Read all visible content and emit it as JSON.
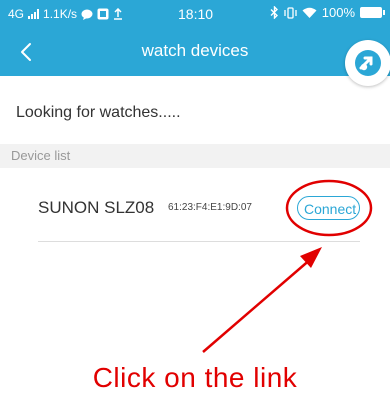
{
  "status_bar": {
    "network": "4G",
    "speed": "1.1K/s",
    "time": "18:10",
    "battery": "100%"
  },
  "nav": {
    "title": "watch devices",
    "back_icon": "chevron-left-icon",
    "settings_icon": "sync-settings-icon"
  },
  "main": {
    "searching_text": "Looking for watches.....",
    "section_header": "Device list",
    "devices": [
      {
        "name": "SUNON SLZ08",
        "mac": "61:23:F4:E1:9D:07",
        "button_label": "Connect"
      }
    ]
  },
  "annotation": {
    "caption": "Click on the link",
    "color": "#e10000"
  },
  "colors": {
    "accent": "#2ba7d6",
    "annotation": "#e10000"
  }
}
